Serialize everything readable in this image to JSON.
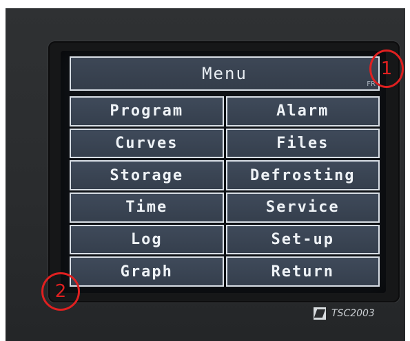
{
  "menu": {
    "title": "Menu",
    "corner_tag": "FR"
  },
  "buttons": [
    "Program",
    "Alarm",
    "Curves",
    "Files",
    "Storage",
    "Defrosting",
    "Time",
    "Service",
    "Log",
    "Set-up",
    "Graph",
    "Return"
  ],
  "annotations": {
    "marker_1": "1",
    "marker_2": "2"
  },
  "device": {
    "model": "TSC2003"
  },
  "colors": {
    "cell_bg": "#3b4554",
    "cell_border": "#d9dfe6",
    "marker_red": "#e02020"
  }
}
